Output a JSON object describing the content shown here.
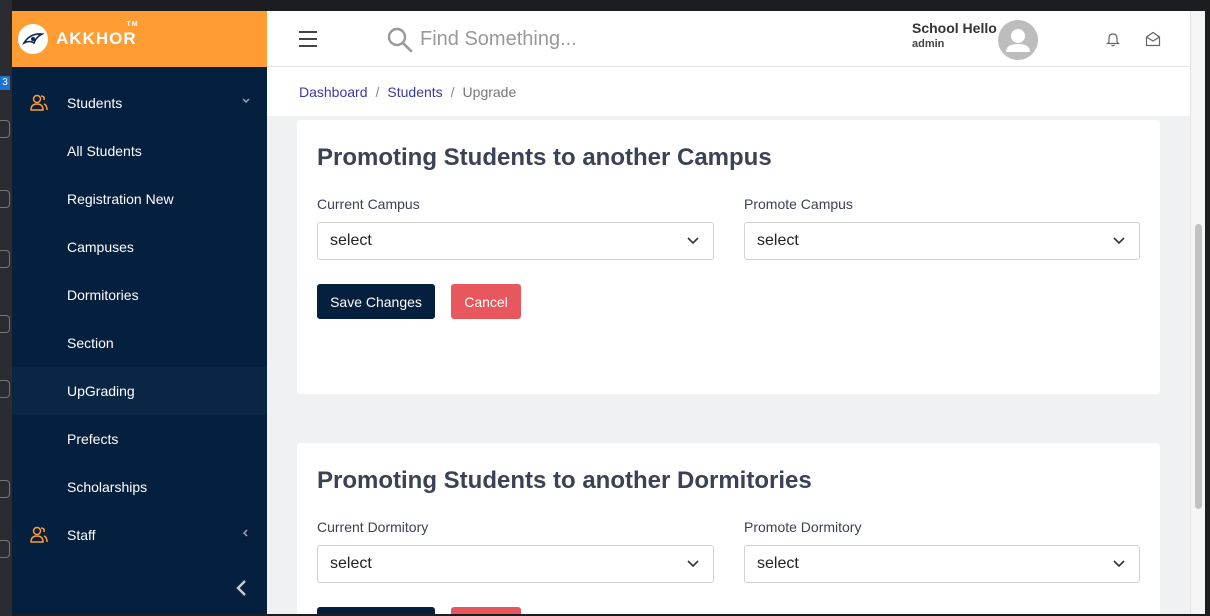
{
  "brand": {
    "name": "AKKHOR",
    "tm": "TM"
  },
  "sidebar": {
    "items": [
      {
        "label": "Students",
        "type": "parent",
        "icon": "users-icon"
      },
      {
        "label": "All Students",
        "type": "child"
      },
      {
        "label": "Registration New",
        "type": "child"
      },
      {
        "label": "Campuses",
        "type": "child"
      },
      {
        "label": "Dormitories",
        "type": "child"
      },
      {
        "label": "Section",
        "type": "child"
      },
      {
        "label": "UpGrading",
        "type": "child",
        "active": true
      },
      {
        "label": "Prefects",
        "type": "child"
      },
      {
        "label": "Scholarships",
        "type": "child"
      },
      {
        "label": "Staff",
        "type": "parent",
        "icon": "users-icon"
      }
    ]
  },
  "topbar": {
    "search_placeholder": "Find Something...",
    "user_name": "School Hello",
    "user_role": "admin"
  },
  "breadcrumb": {
    "items": [
      "Dashboard",
      "Students"
    ],
    "current": "Upgrade"
  },
  "campus_card": {
    "title": "Promoting Students to another Campus",
    "current_label": "Current Campus",
    "current_value": "select",
    "promote_label": "Promote Campus",
    "promote_value": "select",
    "save_label": "Save Changes",
    "cancel_label": "Cancel"
  },
  "dormitory_card": {
    "title": "Promoting Students to another Dormitories",
    "current_label": "Current Dormitory",
    "current_value": "select",
    "promote_label": "Promote Dormitory",
    "promote_value": "select"
  },
  "desktop": {
    "badge": "3"
  },
  "colors": {
    "brand_orange": "#ff9d34",
    "sidebar_navy": "#051f3e",
    "cancel_red": "#e9575e",
    "link_blue": "#3a3aa5"
  }
}
